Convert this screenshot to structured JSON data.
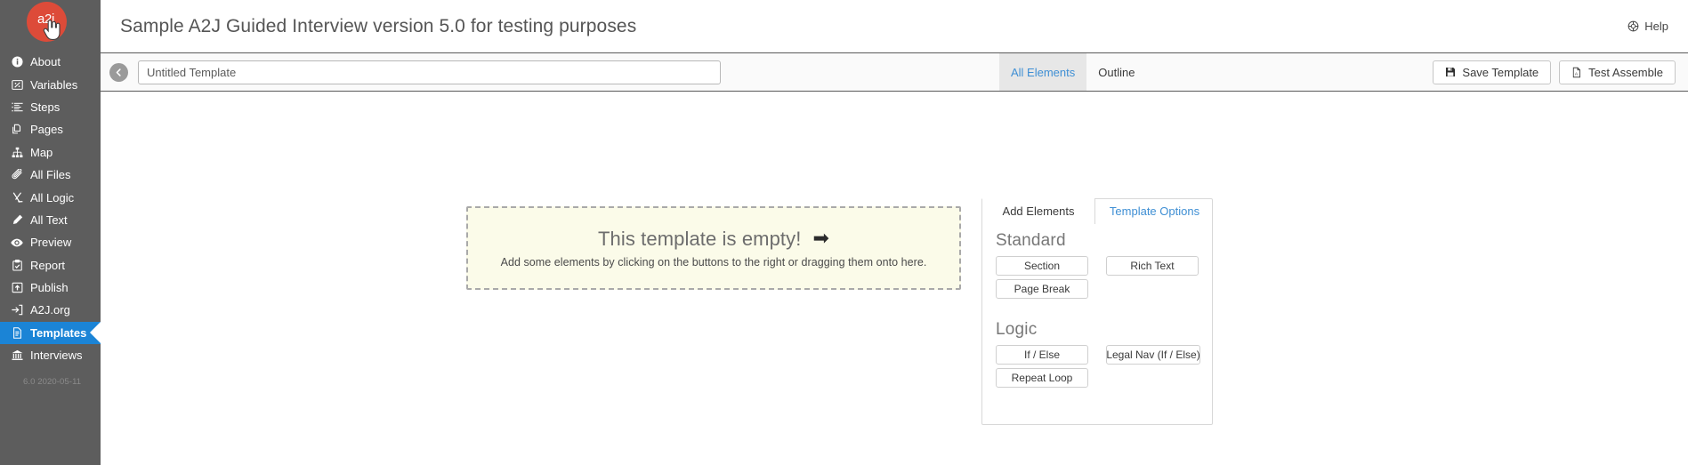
{
  "sidebar": {
    "brand": {
      "label": "a2j",
      "icon": "hand-cursor-icon",
      "color": "#dd4b39"
    },
    "items": [
      {
        "label": "About",
        "icon": "info-circle-icon",
        "active": false
      },
      {
        "label": "Variables",
        "icon": "variables-icon",
        "active": false
      },
      {
        "label": "Steps",
        "icon": "list-ordered-icon",
        "active": false
      },
      {
        "label": "Pages",
        "icon": "copy-pages-icon",
        "active": false
      },
      {
        "label": "Map",
        "icon": "sitemap-icon",
        "active": false
      },
      {
        "label": "All Files",
        "icon": "paperclip-icon",
        "active": false
      },
      {
        "label": "All Logic",
        "icon": "code-branch-icon",
        "active": false
      },
      {
        "label": "All Text",
        "icon": "pencil-icon",
        "active": false
      },
      {
        "label": "Preview",
        "icon": "eye-icon",
        "active": false
      },
      {
        "label": "Report",
        "icon": "clipboard-icon",
        "active": false
      },
      {
        "label": "Publish",
        "icon": "publish-upload-icon",
        "active": false
      },
      {
        "label": "A2J.org",
        "icon": "sign-in-icon",
        "active": false
      },
      {
        "label": "Templates",
        "icon": "file-text-icon",
        "active": true
      },
      {
        "label": "Interviews",
        "icon": "bank-icon",
        "active": false
      }
    ],
    "version": "6.0 2020-05-11",
    "active_color": "#1b84d6",
    "background": "#5d5d5d"
  },
  "header": {
    "title": "Sample A2J Guided Interview version 5.0 for testing purposes",
    "help_label": "Help",
    "help_icon": "help-circle-icon"
  },
  "toolbar": {
    "back_icon": "chevron-left-icon",
    "template_name": {
      "value": "Untitled Template",
      "placeholder": "Untitled Template"
    },
    "tabs": [
      {
        "label": "All Elements",
        "active": true
      },
      {
        "label": "Outline",
        "active": false
      }
    ],
    "save_button": {
      "label": "Save Template",
      "icon": "floppy-save-icon"
    },
    "test_button": {
      "label": "Test Assemble",
      "icon": "pdf-file-icon"
    }
  },
  "canvas": {
    "empty_title": "This template is empty!",
    "empty_arrow": "➡",
    "empty_subtitle": "Add some elements by clicking on the buttons to the right or dragging them onto here."
  },
  "panel": {
    "tabs": [
      {
        "label": "Add Elements",
        "active": true
      },
      {
        "label": "Template Options",
        "active": false
      }
    ],
    "groups": [
      {
        "title": "Standard",
        "rows": [
          {
            "left": "Section",
            "right": "Rich Text"
          },
          {
            "left": "Page Break",
            "right": ""
          }
        ]
      },
      {
        "title": "Logic",
        "rows": [
          {
            "left": "If / Else",
            "right": "Legal Nav (If / Else)"
          },
          {
            "left": "Repeat Loop",
            "right": ""
          }
        ]
      }
    ]
  }
}
